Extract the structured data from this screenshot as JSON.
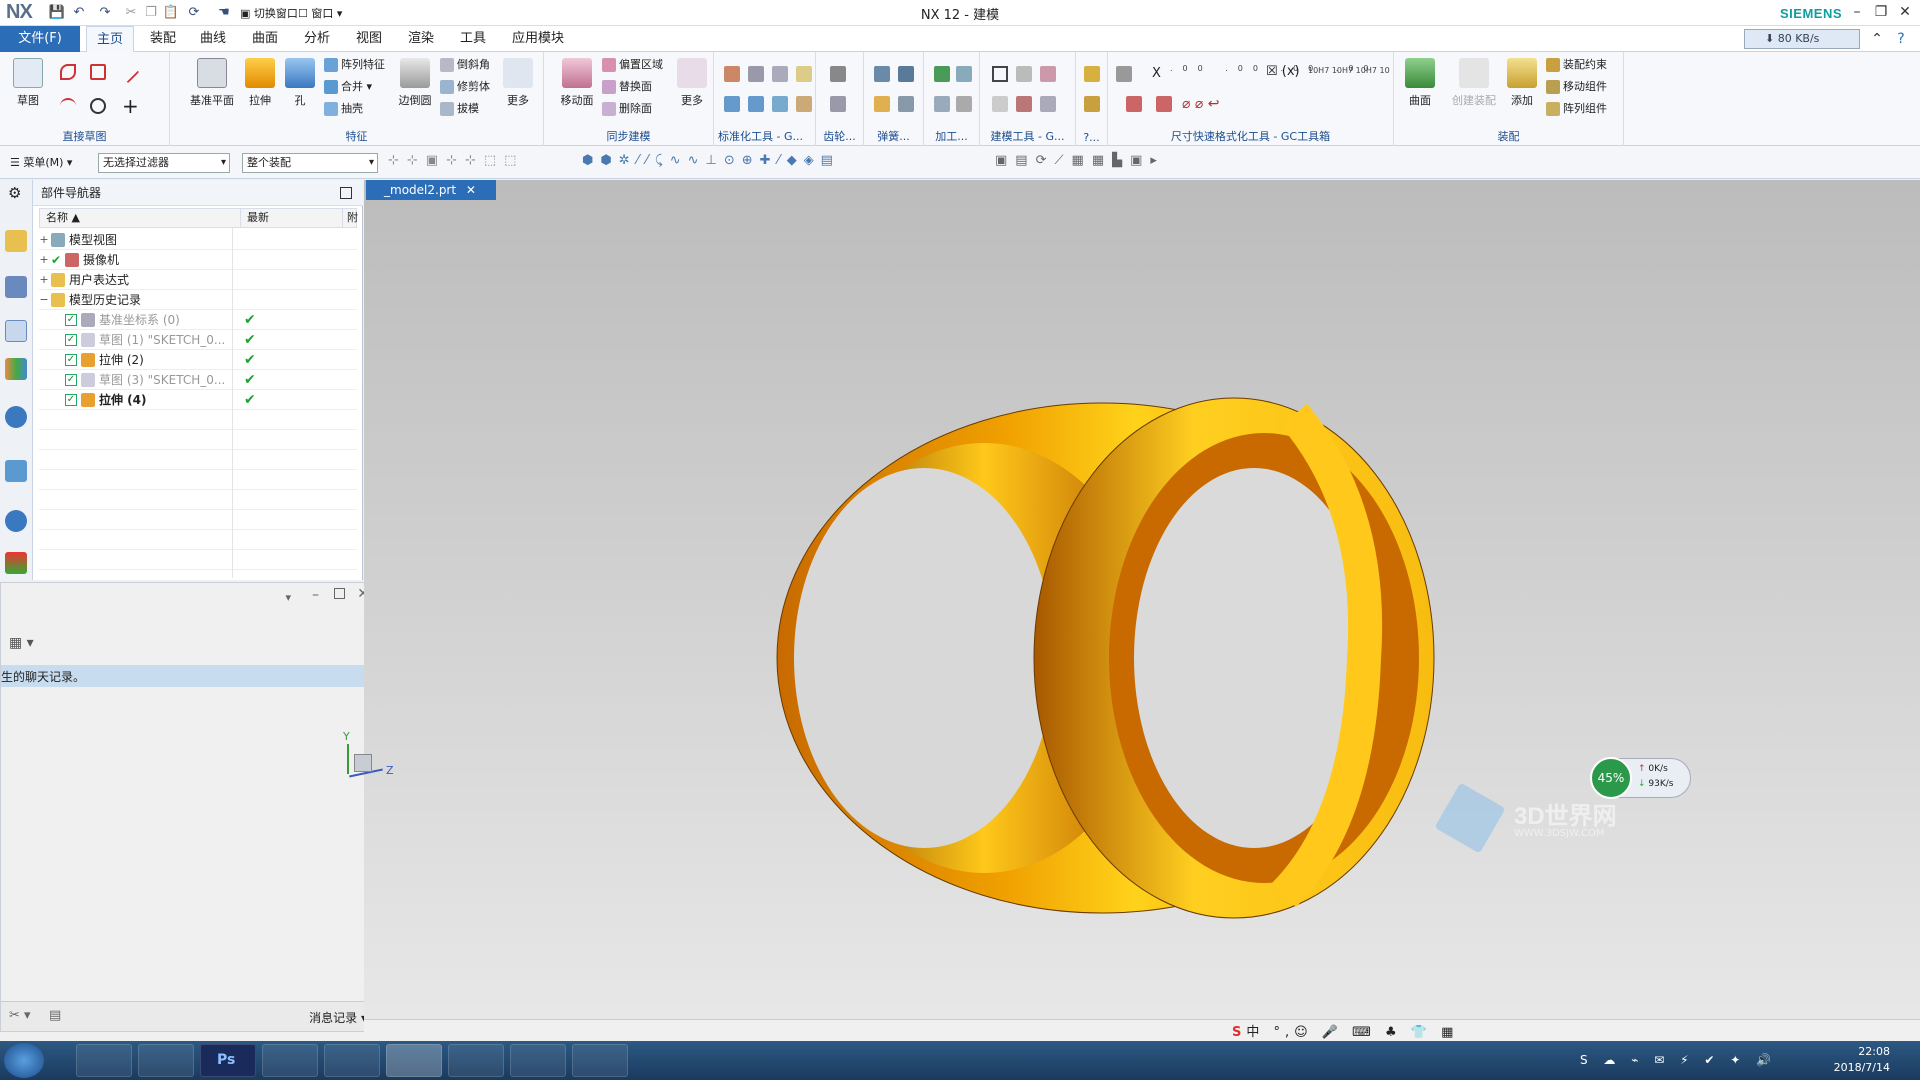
{
  "titlebar": {
    "logo": "NX",
    "title": "NX 12 - 建模",
    "brand": "SIEMENS",
    "switch_window": "切换窗口",
    "window_menu": "窗口"
  },
  "menubar": {
    "file": "文件(F)",
    "tabs": [
      "主页",
      "装配",
      "曲线",
      "曲面",
      "分析",
      "视图",
      "渲染",
      "工具",
      "应用模块"
    ],
    "speed": "80 KB/s"
  },
  "ribbon": {
    "groups": {
      "sketch": "直接草图",
      "feature": "特征",
      "sync": "同步建模",
      "std_tools": "标准化工具 - G...",
      "gear": "齿轮...",
      "spring": "弹簧...",
      "machining": "加工...",
      "modeling_tools": "建模工具 - G...",
      "more_tools": "?...",
      "dim_tools": "尺寸快速格式化工具 - GC工具箱",
      "assembly": "装配"
    },
    "sketch": {
      "label": "草图"
    },
    "feature": {
      "datum_plane": "基准平面",
      "extrude": "拉伸",
      "hole": "孔",
      "pattern_feature": "阵列特征",
      "unite": "合并",
      "shell": "抽壳",
      "edge_blend": "边倒圆",
      "chamfer": "倒斜角",
      "trim_body": "修剪体",
      "draft": "拔模",
      "more": "更多"
    },
    "sync": {
      "move_face": "移动面",
      "offset_region": "偏置区域",
      "replace_face": "替换面",
      "delete_face": "删除面",
      "more": "更多"
    },
    "assembly_btns": {
      "surface": "曲面",
      "component_assembly": "创建装配",
      "add": "添加",
      "assembly_constraint": "装配约束",
      "move_component": "移动组件",
      "pattern_component": "阵列组件"
    }
  },
  "toolbar2": {
    "menu": "菜单(M)",
    "filter": "无选择过滤器",
    "scope": "整个装配"
  },
  "navigator": {
    "title": "部件导航器",
    "col_name": "名称",
    "col_latest": "最新",
    "col_extra": "附",
    "items": [
      {
        "label": "模型视图",
        "level": 0,
        "expand": "+"
      },
      {
        "label": "摄像机",
        "level": 0,
        "expand": "+"
      },
      {
        "label": "用户表达式",
        "level": 0,
        "expand": "+"
      },
      {
        "label": "模型历史记录",
        "level": 0,
        "expand": "−"
      },
      {
        "label": "基准坐标系 (0)",
        "level": 1,
        "dim": true,
        "check": "✔"
      },
      {
        "label": "草图 (1) \"SKETCH_0...",
        "level": 1,
        "dim": true,
        "check": "✔"
      },
      {
        "label": "拉伸 (2)",
        "level": 1,
        "dim": false,
        "check": "✔"
      },
      {
        "label": "草图 (3) \"SKETCH_0...",
        "level": 1,
        "dim": true,
        "check": "✔"
      },
      {
        "label": "拉伸 (4)",
        "level": 1,
        "dim": false,
        "bold": true,
        "check": "✔"
      }
    ]
  },
  "chat": {
    "notice": "生的聊天记录。",
    "footer": "消息记录"
  },
  "viewport": {
    "tab": "_model2.prt",
    "axis_x": "Z",
    "axis_y": "Y"
  },
  "widget": {
    "percent": "45%",
    "up": "0K/s",
    "down": "93K/s"
  },
  "watermark": {
    "cn": "3D世界网",
    "url": "WWW.3DSJW.COM"
  },
  "tray": {
    "time": "22:08",
    "date": "2018/7/14"
  },
  "colors": {
    "accent": "#2c6db8",
    "model_light": "#ffd21a",
    "model_dark": "#c86a00",
    "check": "#18a52c"
  }
}
